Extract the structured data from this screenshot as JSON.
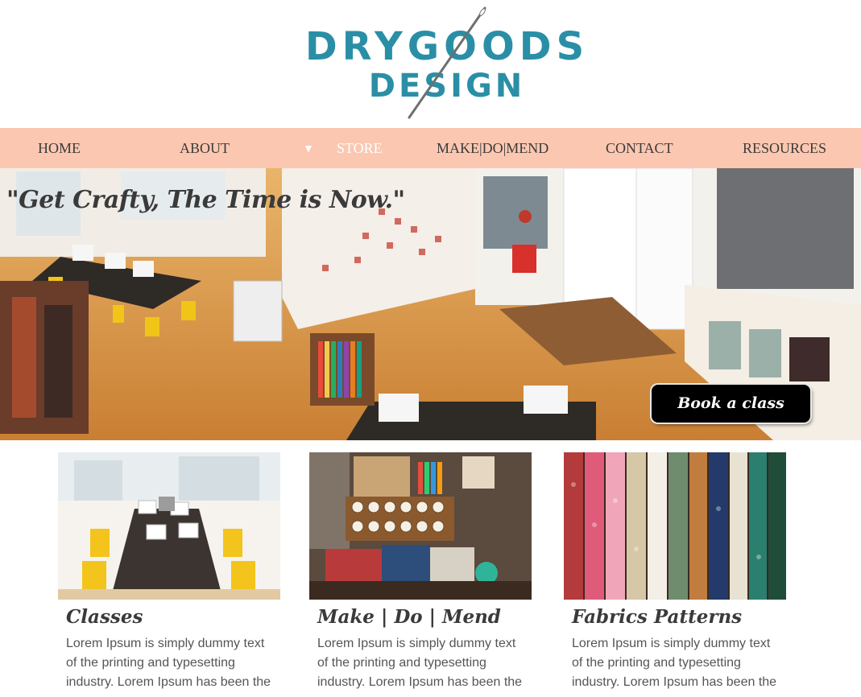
{
  "brand": {
    "logo_line1": "DRYGOODS",
    "logo_line2": "DESIGN",
    "logo_color": "#2a8fa6"
  },
  "nav": {
    "background": "#fcc7b0",
    "items": [
      {
        "label": "HOME"
      },
      {
        "label": "ABOUT"
      },
      {
        "label": "STORE",
        "active": true,
        "dropdown_icon": "triangle-down-icon"
      },
      {
        "label": "MAKE|DO|MEND"
      },
      {
        "label": "CONTACT"
      },
      {
        "label": "RESOURCES"
      }
    ]
  },
  "hero": {
    "tagline": "\"Get Crafty, The Time is Now.\"",
    "cta_label": "Book a class"
  },
  "cards": [
    {
      "title": "Classes",
      "text": "Lorem Ipsum is simply dummy text of the printing and typesetting industry. Lorem Ipsum has been the"
    },
    {
      "title": "Make | Do | Mend",
      "text": "Lorem Ipsum is simply dummy text of the printing and typesetting industry. Lorem Ipsum has been the"
    },
    {
      "title": "Fabrics Patterns",
      "text": "Lorem Ipsum is simply dummy text of the printing and typesetting industry. Lorem Ipsum has been the"
    }
  ]
}
